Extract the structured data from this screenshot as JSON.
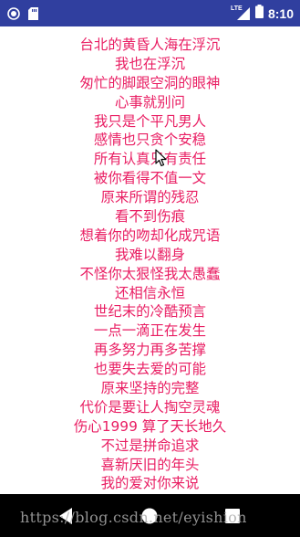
{
  "status_bar": {
    "time": "8:10",
    "network": "LTE",
    "icons": [
      "notification-circle-icon",
      "sd-card-icon",
      "signal-lte-icon",
      "battery-icon"
    ],
    "background": "#303f9f"
  },
  "lyrics": {
    "color": "#e91e63",
    "lines": [
      "台北的黄昏人海在浮沉",
      "我也在浮沉",
      "匆忙的脚跟空洞的眼神",
      "心事就别问",
      "我只是个平凡男人",
      "感情也只贪个安稳",
      "所有认真只有责任",
      "被你看得不值一文",
      "原来所谓的残忍",
      "看不到伤痕",
      "想着你的吻却化成咒语",
      "我难以翻身",
      "不怪你太狠怪我太愚蠢",
      "还相信永恒",
      "世纪末的冷酷预言",
      "一点一滴正在发生",
      "再多努力再多苦撑",
      "也要失去爱的可能",
      "原来坚持的完整",
      "代价是要让人掏空灵魂",
      "伤心1999 算了天长地久",
      "不过是拼命追求",
      "喜新厌旧的年头",
      "我的爱对你来说"
    ]
  },
  "nav_bar": {
    "icons": [
      "back-icon",
      "home-icon",
      "recents-icon"
    ]
  },
  "watermark": "https://blog.csdn.net/eyishion"
}
